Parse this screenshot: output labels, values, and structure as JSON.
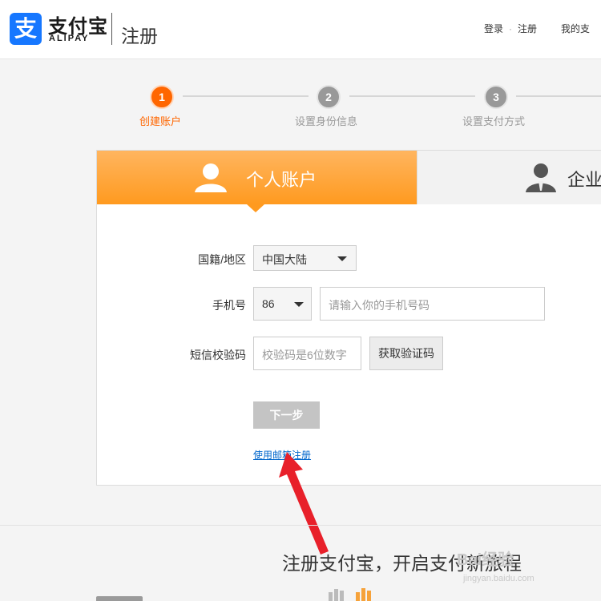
{
  "header": {
    "logo_glyph": "支",
    "brand_name_cn": "支付宝",
    "brand_name_en": "ALIPAY",
    "page_name": "注册",
    "nav": {
      "login": "登录",
      "separator": "·",
      "register": "注册",
      "my_account": "我的支"
    }
  },
  "steps": [
    {
      "number": "1",
      "label": "创建账户",
      "state": "active"
    },
    {
      "number": "2",
      "label": "设置身份信息",
      "state": "inactive"
    },
    {
      "number": "3",
      "label": "设置支付方式",
      "state": "inactive"
    }
  ],
  "tabs": {
    "personal": {
      "label": "个人账户",
      "icon": "person-icon"
    },
    "corporate": {
      "label": "企业账",
      "icon": "business-person-icon"
    }
  },
  "form": {
    "region": {
      "label": "国籍/地区",
      "value": "中国大陆"
    },
    "phone": {
      "label": "手机号",
      "country_code": "86",
      "placeholder": "请输入你的手机号码"
    },
    "sms": {
      "label": "短信校验码",
      "placeholder": "校验码是6位数字",
      "button": "获取验证码"
    },
    "next_button": "下一步",
    "email_link": "使用邮箱注册"
  },
  "footer": {
    "slogan": "注册支付宝，开启支付新旅程",
    "watermark": "Bai经验",
    "watermark_url": "jingyan.baidu.com"
  },
  "colors": {
    "accent": "#ff6600",
    "tab_orange": "#ff9a1f",
    "brand_blue": "#1677ff",
    "link_blue": "#0066cc",
    "arrow_red": "#e8202a"
  }
}
